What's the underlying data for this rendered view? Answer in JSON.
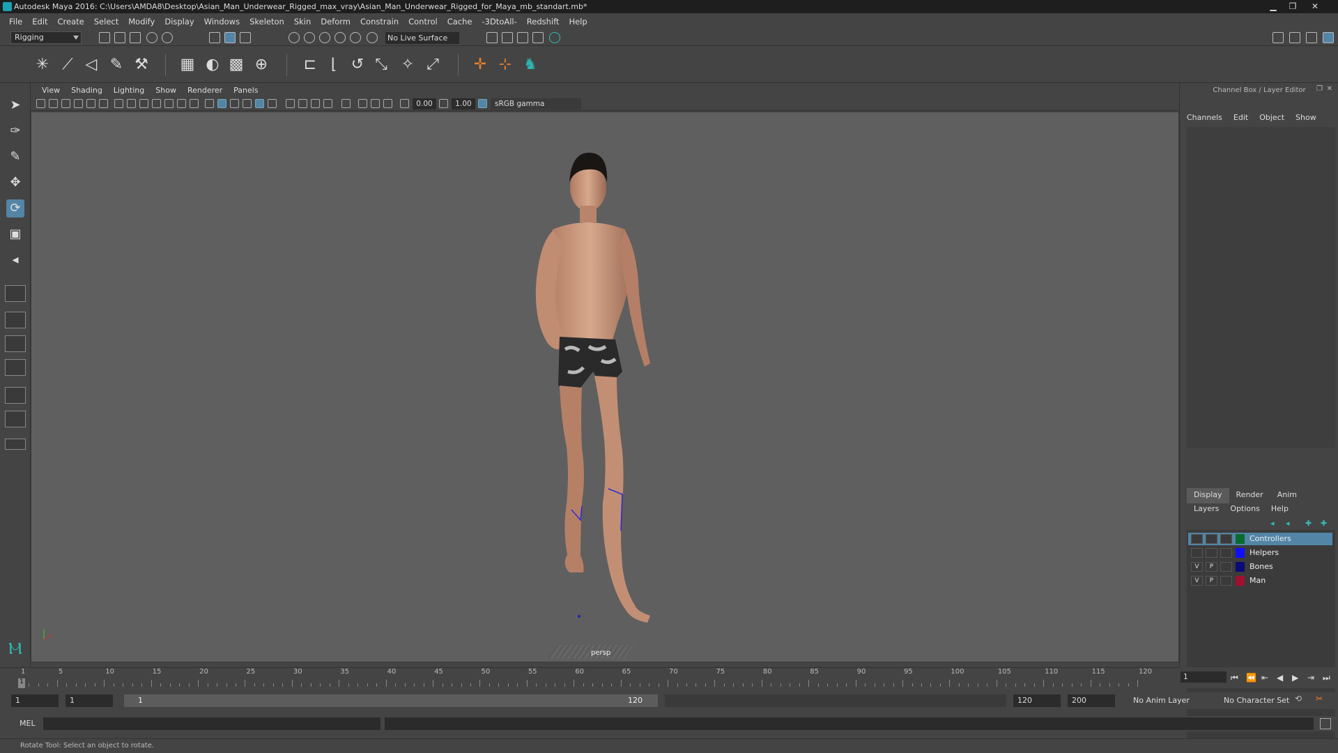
{
  "window": {
    "title": "Autodesk Maya 2016: C:\\Users\\AMDA8\\Desktop\\Asian_Man_Underwear_Rigged_max_vray\\Asian_Man_Underwear_Rigged_for_Maya_mb_standart.mb*",
    "minimize": "▁",
    "restore": "❐",
    "close": "✕"
  },
  "menubar": [
    "File",
    "Edit",
    "Create",
    "Select",
    "Modify",
    "Display",
    "Windows",
    "Skeleton",
    "Skin",
    "Deform",
    "Constrain",
    "Control",
    "Cache",
    "-3DtoAll-",
    "Redshift",
    "Help"
  ],
  "statusline": {
    "mode": "Rigging",
    "live_surface": "No Live Surface"
  },
  "panel_menu": [
    "View",
    "Shading",
    "Lighting",
    "Show",
    "Renderer",
    "Panels"
  ],
  "panel_toolbar": {
    "exposure": "0.00",
    "gamma": "1.00",
    "color_space": "sRGB gamma"
  },
  "viewport": {
    "camera": "persp"
  },
  "channel_box": {
    "title": "Channel Box / Layer Editor",
    "tabs": [
      "Channels",
      "Edit",
      "Object",
      "Show"
    ]
  },
  "layer_editor": {
    "tabs": [
      "Display",
      "Render",
      "Anim"
    ],
    "selected_tab": "Display",
    "menu": [
      "Layers",
      "Options",
      "Help"
    ],
    "layers": [
      {
        "name": "Controllers",
        "v": "",
        "p": "",
        "color": "#0b6b2e",
        "selected": true
      },
      {
        "name": "Helpers",
        "v": "",
        "p": "",
        "color": "#1010ff",
        "selected": false
      },
      {
        "name": "Bones",
        "v": "V",
        "p": "P",
        "color": "#0a0a78",
        "selected": false
      },
      {
        "name": "Man",
        "v": "V",
        "p": "P",
        "color": "#a01030",
        "selected": false
      }
    ]
  },
  "time_slider": {
    "start": 1,
    "end": 120,
    "current": 1,
    "labels": [
      "1",
      "5",
      "10",
      "15",
      "20",
      "25",
      "30",
      "35",
      "40",
      "45",
      "50",
      "55",
      "60",
      "65",
      "70",
      "75",
      "80",
      "85",
      "90",
      "95",
      "100",
      "105",
      "110",
      "115",
      "120"
    ],
    "current_frame_field": "1"
  },
  "range_slider": {
    "start_field": "1",
    "anim_start_field": "1",
    "range_start": "1",
    "range_end": "120",
    "end_field": "120",
    "anim_end_field": "200",
    "anim_layer": "No Anim Layer",
    "character_set": "No Character Set"
  },
  "command_line": {
    "language": "MEL"
  },
  "help_line": {
    "text": "Rotate Tool: Select an object to rotate."
  }
}
